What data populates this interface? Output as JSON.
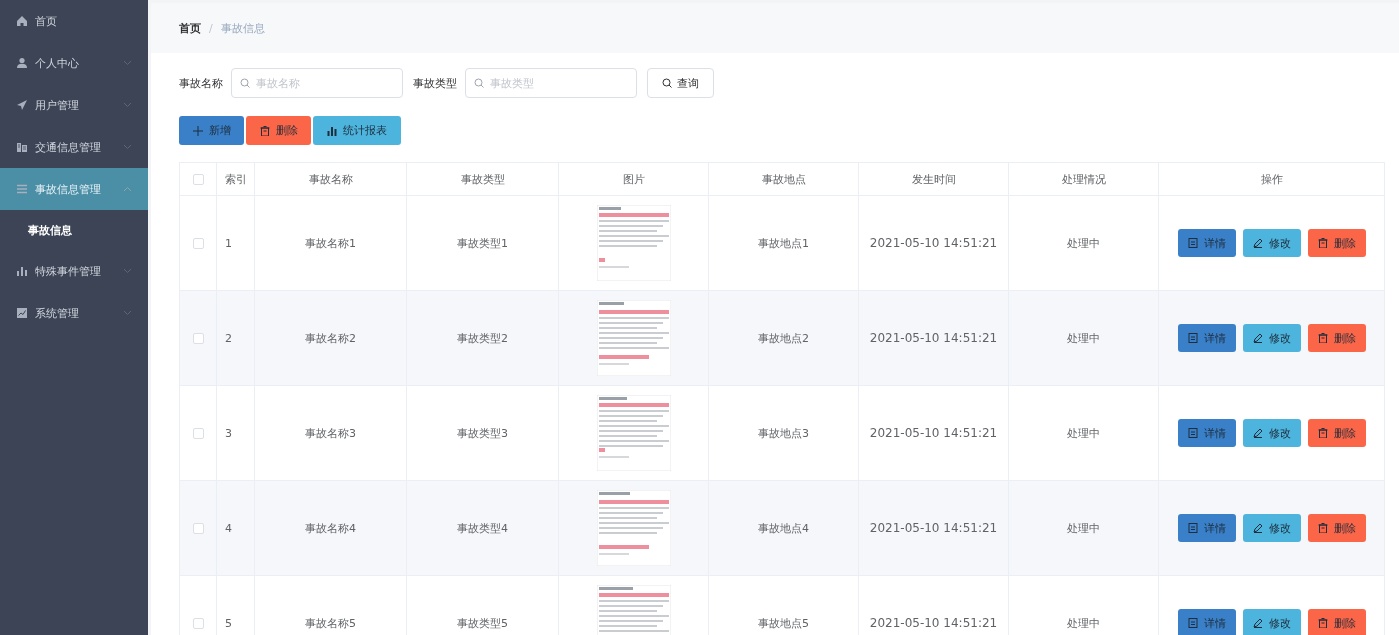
{
  "sidebar": {
    "items": [
      {
        "label": "首页",
        "selected": false
      },
      {
        "label": "个人中心",
        "selected": false,
        "expanded": false
      },
      {
        "label": "用户管理",
        "selected": false,
        "expanded": false
      },
      {
        "label": "交通信息管理",
        "selected": false,
        "expanded": false
      },
      {
        "label": "事故信息管理",
        "selected": true,
        "expanded": true,
        "children": [
          {
            "label": "事故信息",
            "selected": true
          }
        ]
      },
      {
        "label": "特殊事件管理",
        "selected": false,
        "expanded": false
      },
      {
        "label": "系统管理",
        "selected": false,
        "expanded": false
      }
    ]
  },
  "breadcrumb": {
    "items": [
      "首页",
      "事故信息"
    ],
    "separator": "/"
  },
  "search": {
    "fields": [
      {
        "label": "事故名称",
        "placeholder": "事故名称"
      },
      {
        "label": "事故类型",
        "placeholder": "事故类型"
      }
    ],
    "button": "查询"
  },
  "toolbar": [
    {
      "label": "新增",
      "kind": "add"
    },
    {
      "label": "删除",
      "kind": "delete"
    },
    {
      "label": "统计报表",
      "kind": "report"
    }
  ],
  "table": {
    "select_all_checked": false,
    "columns": [
      "索引",
      "事故名称",
      "事故类型",
      "图片",
      "事故地点",
      "发生时间",
      "处理情况",
      "操作"
    ],
    "rows": [
      {
        "checked": false,
        "index": "1",
        "name": "事故名称1",
        "type": "事故类型1",
        "place": "事故地点1",
        "time": "2021-05-10 14:51:21",
        "status": "处理中",
        "actions": [
          {
            "label": "详情",
            "kind": "detail"
          },
          {
            "label": "修改",
            "kind": "edit"
          },
          {
            "label": "删除",
            "kind": "delete"
          }
        ]
      },
      {
        "checked": false,
        "index": "2",
        "name": "事故名称2",
        "type": "事故类型2",
        "place": "事故地点2",
        "time": "2021-05-10 14:51:21",
        "status": "处理中",
        "actions": [
          {
            "label": "详情",
            "kind": "detail"
          },
          {
            "label": "修改",
            "kind": "edit"
          },
          {
            "label": "删除",
            "kind": "delete"
          }
        ]
      },
      {
        "checked": false,
        "index": "3",
        "name": "事故名称3",
        "type": "事故类型3",
        "place": "事故地点3",
        "time": "2021-05-10 14:51:21",
        "status": "处理中",
        "actions": [
          {
            "label": "详情",
            "kind": "detail"
          },
          {
            "label": "修改",
            "kind": "edit"
          },
          {
            "label": "删除",
            "kind": "delete"
          }
        ]
      },
      {
        "checked": false,
        "index": "4",
        "name": "事故名称4",
        "type": "事故类型4",
        "place": "事故地点4",
        "time": "2021-05-10 14:51:21",
        "status": "处理中",
        "actions": [
          {
            "label": "详情",
            "kind": "detail"
          },
          {
            "label": "修改",
            "kind": "edit"
          },
          {
            "label": "删除",
            "kind": "delete"
          }
        ]
      },
      {
        "checked": false,
        "index": "5",
        "name": "事故名称5",
        "type": "事故类型5",
        "place": "事故地点5",
        "time": "2021-05-10 14:51:21",
        "status": "处理中",
        "actions": [
          {
            "label": "详情",
            "kind": "detail"
          },
          {
            "label": "修改",
            "kind": "edit"
          },
          {
            "label": "删除",
            "kind": "delete"
          }
        ]
      }
    ]
  }
}
